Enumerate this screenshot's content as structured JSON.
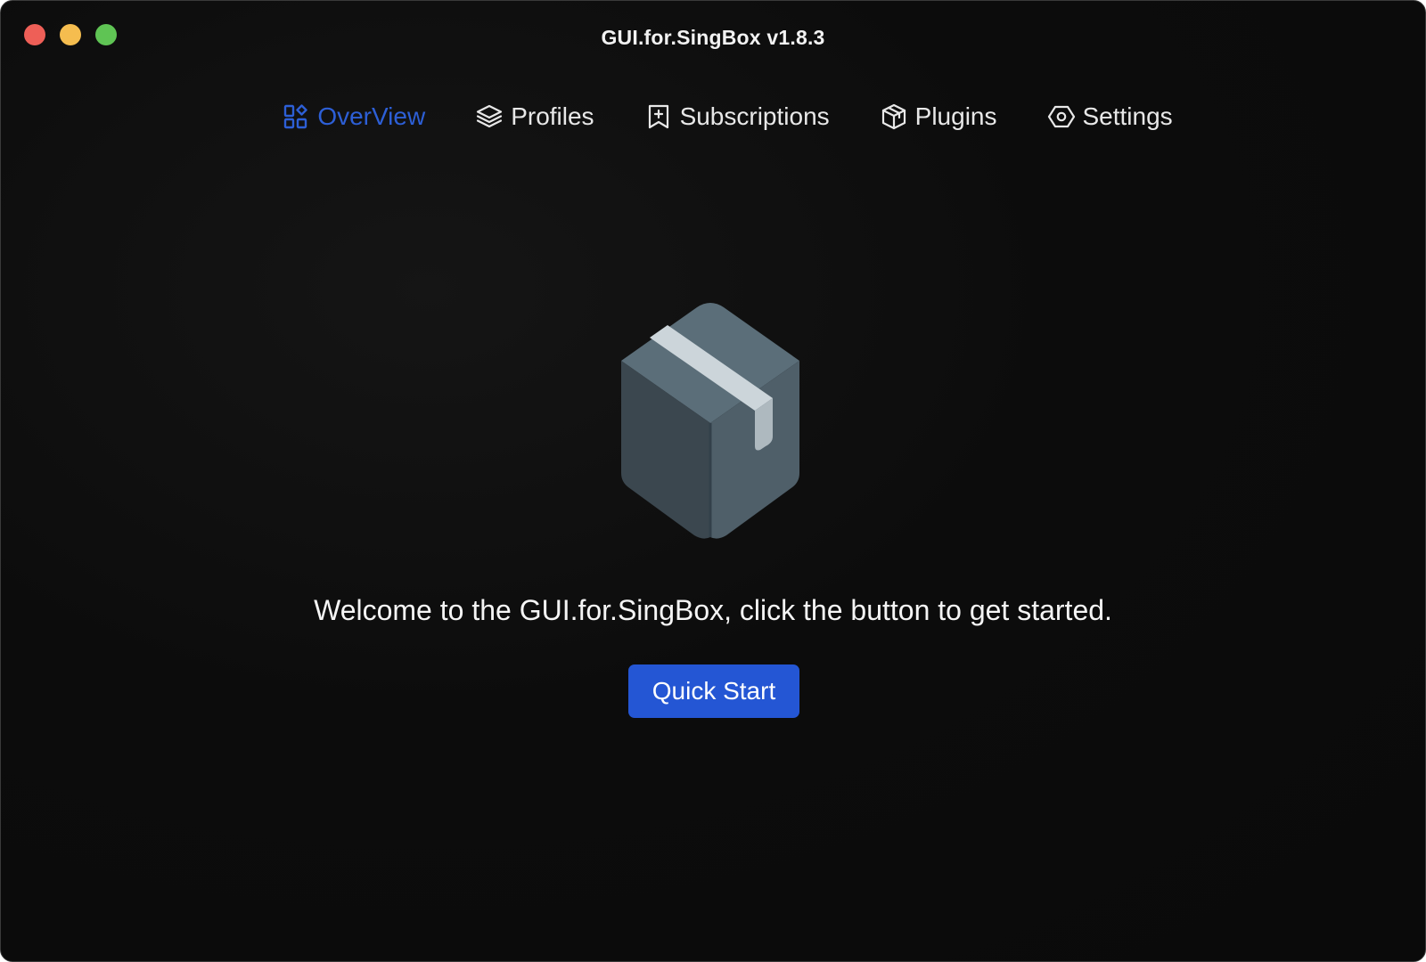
{
  "window": {
    "title": "GUI.for.SingBox v1.8.3"
  },
  "traffic_lights": {
    "close_color": "#ee5f57",
    "minimize_color": "#f5bd4f",
    "zoom_color": "#5fc454"
  },
  "nav": {
    "active_color": "#2d5fd6",
    "items": [
      {
        "label": "OverView",
        "icon": "overview-grid-icon",
        "active": true
      },
      {
        "label": "Profiles",
        "icon": "layers-icon",
        "active": false
      },
      {
        "label": "Subscriptions",
        "icon": "bookmark-plus-icon",
        "active": false
      },
      {
        "label": "Plugins",
        "icon": "cube-icon",
        "active": false
      },
      {
        "label": "Settings",
        "icon": "hexagon-gear-icon",
        "active": false
      }
    ]
  },
  "main": {
    "hero_icon": "package-box-icon",
    "welcome_text": "Welcome to the GUI.for.SingBox, click the button to get started.",
    "quick_start_label": "Quick Start",
    "button_color": "#2456d4"
  }
}
